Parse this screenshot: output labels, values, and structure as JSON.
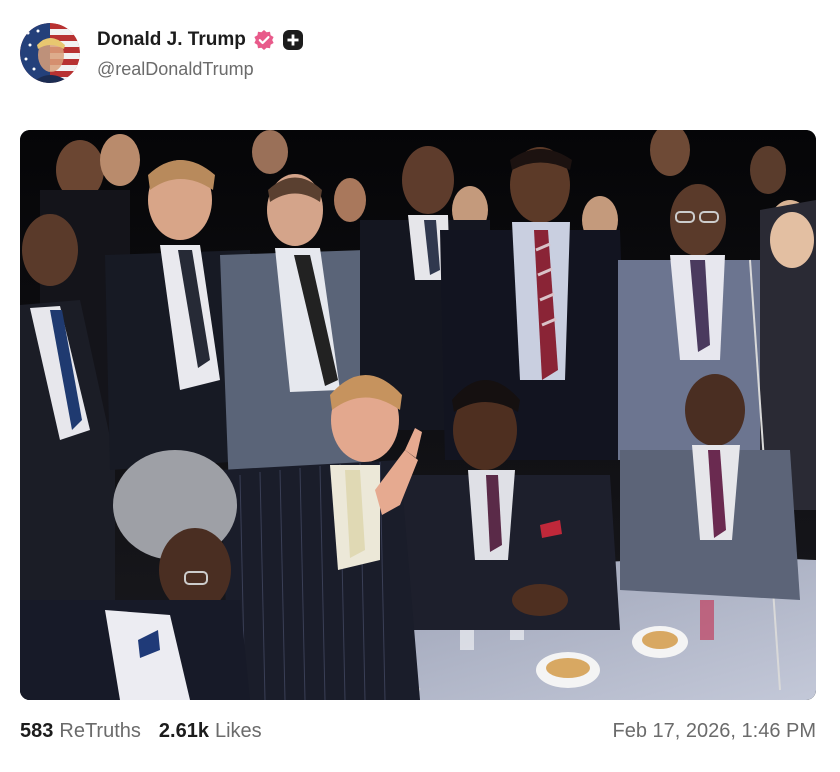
{
  "post": {
    "author": {
      "display_name": "Donald J. Trump",
      "handle": "@realDonaldTrump",
      "avatar_icon": "avatar-flag-portrait",
      "verified_icon": "verified-badge-icon",
      "extra_icon": "plus-badge-icon",
      "verified_color": "#e85a8a"
    },
    "media": {
      "type": "photo"
    },
    "stats": {
      "retruths_count": "583",
      "retruths_label": "ReTruths",
      "likes_count": "2.61k",
      "likes_label": "Likes"
    },
    "timestamp": "Feb 17, 2026, 1:46 PM"
  }
}
